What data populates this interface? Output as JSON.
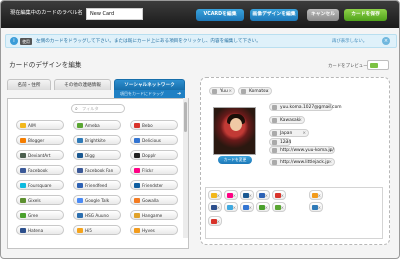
{
  "topbar": {
    "label": "現在編集中のカードのラベル名",
    "card_name": "New Card",
    "vcard_button": "VCARDを編集",
    "image_button": "画像デザインを編集",
    "cancel_button": "キャンセル",
    "save_button": "カードを保存"
  },
  "info": {
    "badge": "使用",
    "text": "左側のカードをドラッグして下さい。または既にカード上にある項目をクリックし、内容を編集して下さい。",
    "hide_link": "再び表示しない。",
    "close": "×"
  },
  "editor": {
    "title": "カードのデザインを編集",
    "preview_label": "カードをプレビュー："
  },
  "tabs": [
    {
      "label": "名前・住所"
    },
    {
      "label": "その他の連絡情報"
    },
    {
      "label": "ソーシャルネットワーク"
    }
  ],
  "drag_hint": "項目をカードにドラッグ",
  "filter": {
    "placeholder": "フィルタ"
  },
  "networks": [
    {
      "label": "AIM",
      "color": "#f2b71c"
    },
    {
      "label": "Ameba",
      "color": "#5aa632"
    },
    {
      "label": "Bebo",
      "color": "#d8332a"
    },
    {
      "label": "Blogger",
      "color": "#f57d00"
    },
    {
      "label": "Brightkite",
      "color": "#2f7ab8"
    },
    {
      "label": "Delicious",
      "color": "#3274d2"
    },
    {
      "label": "DeviantArt",
      "color": "#4b5e4e"
    },
    {
      "label": "Digg",
      "color": "#1a5891"
    },
    {
      "label": "Dopplr",
      "color": "#222222"
    },
    {
      "label": "Facebook",
      "color": "#3b5998"
    },
    {
      "label": "Facebook Fan",
      "color": "#3b5998"
    },
    {
      "label": "Flickr",
      "color": "#ff0084"
    },
    {
      "label": "Foursquare",
      "color": "#0cbadf"
    },
    {
      "label": "Friendfeed",
      "color": "#2d62b5"
    },
    {
      "label": "Friendster",
      "color": "#0f5ea0"
    },
    {
      "label": "Gixels",
      "color": "#5c8f2f"
    },
    {
      "label": "Google Talk",
      "color": "#4a8af4"
    },
    {
      "label": "Gowalla",
      "color": "#f47b20"
    },
    {
      "label": "Gree",
      "color": "#4aa02c"
    },
    {
      "label": "HSG Auuno",
      "color": "#2c6fb0"
    },
    {
      "label": "Hangame",
      "color": "#e0a22a"
    },
    {
      "label": "Hatena",
      "color": "#2c4f8c"
    },
    {
      "label": "Hi5",
      "color": "#f4a31c"
    },
    {
      "label": "Hyves",
      "color": "#f29b1c"
    }
  ],
  "card": {
    "first_name": "Yuu",
    "last_name": "Komatsu",
    "email": "yuu.koma.1027@gmail.com",
    "city": "Kawasaki",
    "country": "Japan",
    "zip": "1234",
    "url1": "http://www.yuu-koma.jp/",
    "url2": "http://www.littlejack.jp",
    "change_image": "カードを変更",
    "close_mark": "×"
  },
  "social_icons": [
    {
      "name": "aim",
      "color": "#f2b71c"
    },
    {
      "name": "flickr",
      "color": "#ff0084"
    },
    {
      "name": "digg",
      "color": "#1a5891"
    },
    {
      "name": "friendfeed",
      "color": "#2d62b5"
    },
    {
      "name": "bebo",
      "color": "#d8332a"
    },
    {
      "name": "hyves",
      "color": "#f29b1c"
    },
    {
      "name": "hatena",
      "color": "#2c4f8c"
    },
    {
      "name": "twitter",
      "color": "#3fa9e0"
    },
    {
      "name": "delicious",
      "color": "#3274d2"
    },
    {
      "name": "gree",
      "color": "#4aa02c"
    },
    {
      "name": "ameba",
      "color": "#5aa632"
    },
    {
      "name": "brightkite",
      "color": "#2f7ab8"
    },
    {
      "name": "youtube",
      "color": "#d8332a"
    }
  ]
}
